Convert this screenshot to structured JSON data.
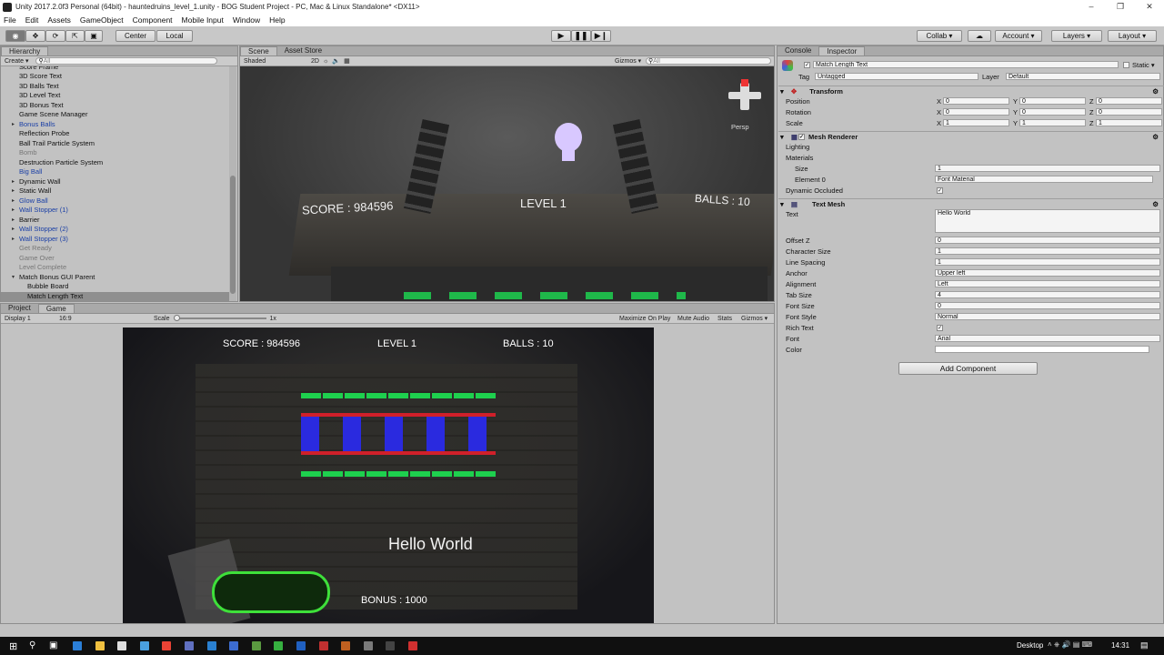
{
  "window": {
    "title": "Unity 2017.2.0f3 Personal (64bit) - hauntedruins_level_1.unity - BOG Student Project - PC, Mac & Linux Standalone* <DX11>"
  },
  "menu": [
    "File",
    "Edit",
    "Assets",
    "GameObject",
    "Component",
    "Mobile Input",
    "Window",
    "Help"
  ],
  "toolbar": {
    "center": "Center",
    "local": "Local",
    "collab": "Collab ▾",
    "account": "Account ▾",
    "layers": "Layers ▾",
    "layout": "Layout ▾"
  },
  "hierarchy": {
    "tab": "Hierarchy",
    "create": "Create ▾",
    "search_placeholder": "All",
    "items": [
      {
        "label": "Score Frame",
        "style": "",
        "fold": false
      },
      {
        "label": "3D Score Text",
        "style": "",
        "fold": false
      },
      {
        "label": "3D Balls Text",
        "style": "",
        "fold": false
      },
      {
        "label": "3D Level Text",
        "style": "",
        "fold": false
      },
      {
        "label": "3D Bonus Text",
        "style": "",
        "fold": false
      },
      {
        "label": "Game Scene Manager",
        "style": "",
        "fold": false
      },
      {
        "label": "Bonus Balls",
        "style": "blue",
        "fold": true
      },
      {
        "label": "Reflection Probe",
        "style": "",
        "fold": false
      },
      {
        "label": "Ball Trail Particle System",
        "style": "",
        "fold": false
      },
      {
        "label": "Bomb",
        "style": "gray",
        "fold": false
      },
      {
        "label": "Destruction Particle System",
        "style": "",
        "fold": false
      },
      {
        "label": "Big Ball",
        "style": "blue",
        "fold": false
      },
      {
        "label": "Dynamic Wall",
        "style": "",
        "fold": true
      },
      {
        "label": "Static Wall",
        "style": "",
        "fold": true
      },
      {
        "label": "Glow Ball",
        "style": "blue",
        "fold": true
      },
      {
        "label": "Wall Stopper (1)",
        "style": "blue",
        "fold": true
      },
      {
        "label": "Barrier",
        "style": "",
        "fold": true
      },
      {
        "label": "Wall Stopper (2)",
        "style": "blue",
        "fold": true
      },
      {
        "label": "Wall Stopper (3)",
        "style": "blue",
        "fold": true
      },
      {
        "label": "Get Ready",
        "style": "gray",
        "fold": false
      },
      {
        "label": "Game Over",
        "style": "gray",
        "fold": false
      },
      {
        "label": "Level Complete",
        "style": "gray",
        "fold": false
      },
      {
        "label": "Match Bonus GUI Parent",
        "style": "",
        "fold": true
      },
      {
        "label": "Bubble Board",
        "style": "",
        "fold": false,
        "indent": true
      },
      {
        "label": "Match Length Text",
        "style": "sel",
        "fold": false,
        "indent": true
      }
    ]
  },
  "scene": {
    "tab_scene": "Scene",
    "tab_asset_store": "Asset Store",
    "shaded": "Shaded",
    "mode_2d": "2D",
    "gizmos": "Gizmos ▾",
    "search_placeholder": "All",
    "persp": "Persp",
    "score": "SCORE : 984596",
    "level": "LEVEL 1",
    "balls": "BALLS : 10"
  },
  "game": {
    "tab_project": "Project",
    "tab_game": "Game",
    "display": "Display 1",
    "aspect": "16:9",
    "scale_label": "Scale",
    "scale_value": "1x",
    "maximize": "Maximize On Play",
    "mute": "Mute Audio",
    "stats": "Stats",
    "gizmos": "Gizmos ▾",
    "score": "SCORE : 984596",
    "level": "LEVEL 1",
    "balls": "BALLS : 10",
    "hello": "Hello World",
    "bonus": "BONUS : 1000"
  },
  "console": {
    "tab": "Console"
  },
  "inspector": {
    "tab": "Inspector",
    "object_name": "Match Length Text",
    "static": "Static ▾",
    "tag_label": "Tag",
    "tag_value": "Untagged",
    "layer_label": "Layer",
    "layer_value": "Default",
    "transform": {
      "title": "Transform",
      "position": "Position",
      "rotation": "Rotation",
      "scale": "Scale",
      "pos": [
        "0",
        "0",
        "0"
      ],
      "rot": [
        "0",
        "0",
        "0"
      ],
      "scl": [
        "1",
        "1",
        "1"
      ]
    },
    "mesh_renderer": {
      "title": "Mesh Renderer",
      "lighting": "Lighting",
      "materials": "Materials",
      "size_label": "Size",
      "size_value": "1",
      "element0_label": "Element 0",
      "element0_value": "Font Material",
      "dynamic_occluded": "Dynamic Occluded"
    },
    "text_mesh": {
      "title": "Text Mesh",
      "text_label": "Text",
      "text_value": "Hello World",
      "rows": [
        {
          "label": "Offset Z",
          "value": "0"
        },
        {
          "label": "Character Size",
          "value": "1"
        },
        {
          "label": "Line Spacing",
          "value": "1"
        },
        {
          "label": "Anchor",
          "value": "Upper left"
        },
        {
          "label": "Alignment",
          "value": "Left"
        },
        {
          "label": "Tab Size",
          "value": "4"
        },
        {
          "label": "Font Size",
          "value": "0"
        },
        {
          "label": "Font Style",
          "value": "Normal"
        },
        {
          "label": "Rich Text",
          "value": ""
        },
        {
          "label": "Font",
          "value": "Arial"
        },
        {
          "label": "Color",
          "value": ""
        }
      ]
    },
    "add_component": "Add Component"
  },
  "taskbar": {
    "desktop": "Desktop",
    "time": "14:31"
  }
}
